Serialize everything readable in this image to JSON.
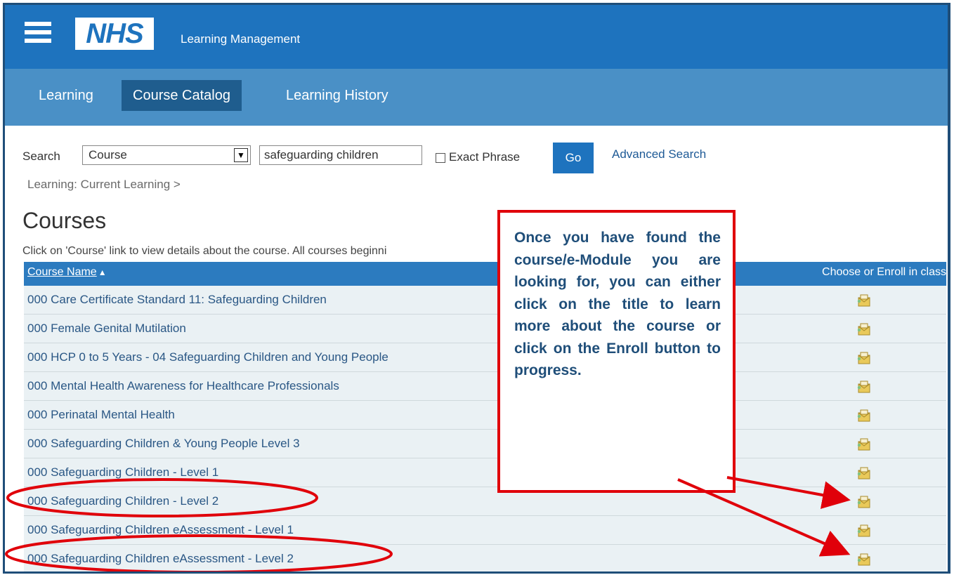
{
  "header": {
    "logo": "NHS",
    "app_title": "Learning Management"
  },
  "tabs": [
    {
      "label": "Learning"
    },
    {
      "label": "Course Catalog",
      "active": true
    },
    {
      "label": "Learning History"
    }
  ],
  "search": {
    "label": "Search",
    "type_value": "Course",
    "query_value": "safeguarding children",
    "exact_phrase_label": "Exact Phrase",
    "go_label": "Go",
    "advanced_label": "Advanced Search"
  },
  "breadcrumb": "Learning: Current Learning  >",
  "page": {
    "title": "Courses",
    "description": "Click on 'Course' link to view details about the course. All courses beginni"
  },
  "table": {
    "col_name": "Course Name",
    "col_enroll": "Choose or Enroll in class",
    "rows": [
      {
        "name": "000 Care Certificate Standard 11: Safeguarding Children"
      },
      {
        "name": "000 Female Genital Mutilation"
      },
      {
        "name": "000 HCP 0 to 5 Years - 04 Safeguarding Children and Young People"
      },
      {
        "name": "000 Mental Health Awareness for Healthcare Professionals"
      },
      {
        "name": "000 Perinatal Mental Health"
      },
      {
        "name": "000 Safeguarding Children & Young People Level 3"
      },
      {
        "name": "000 Safeguarding Children - Level 1"
      },
      {
        "name": "000 Safeguarding Children - Level 2"
      },
      {
        "name": "000 Safeguarding Children eAssessment - Level 1"
      },
      {
        "name": "000 Safeguarding Children eAssessment - Level 2"
      }
    ]
  },
  "callout": {
    "text": "Once you have found the course/e-Module you are looking for, you can either click on the title to learn more about the course or click on the Enroll button to progress."
  },
  "colors": {
    "header_blue": "#1e73be",
    "tab_bar_blue": "#4a90c6",
    "active_tab": "#1f5d8e",
    "annotation_red": "#e0000a",
    "callout_text": "#1f4e79"
  }
}
